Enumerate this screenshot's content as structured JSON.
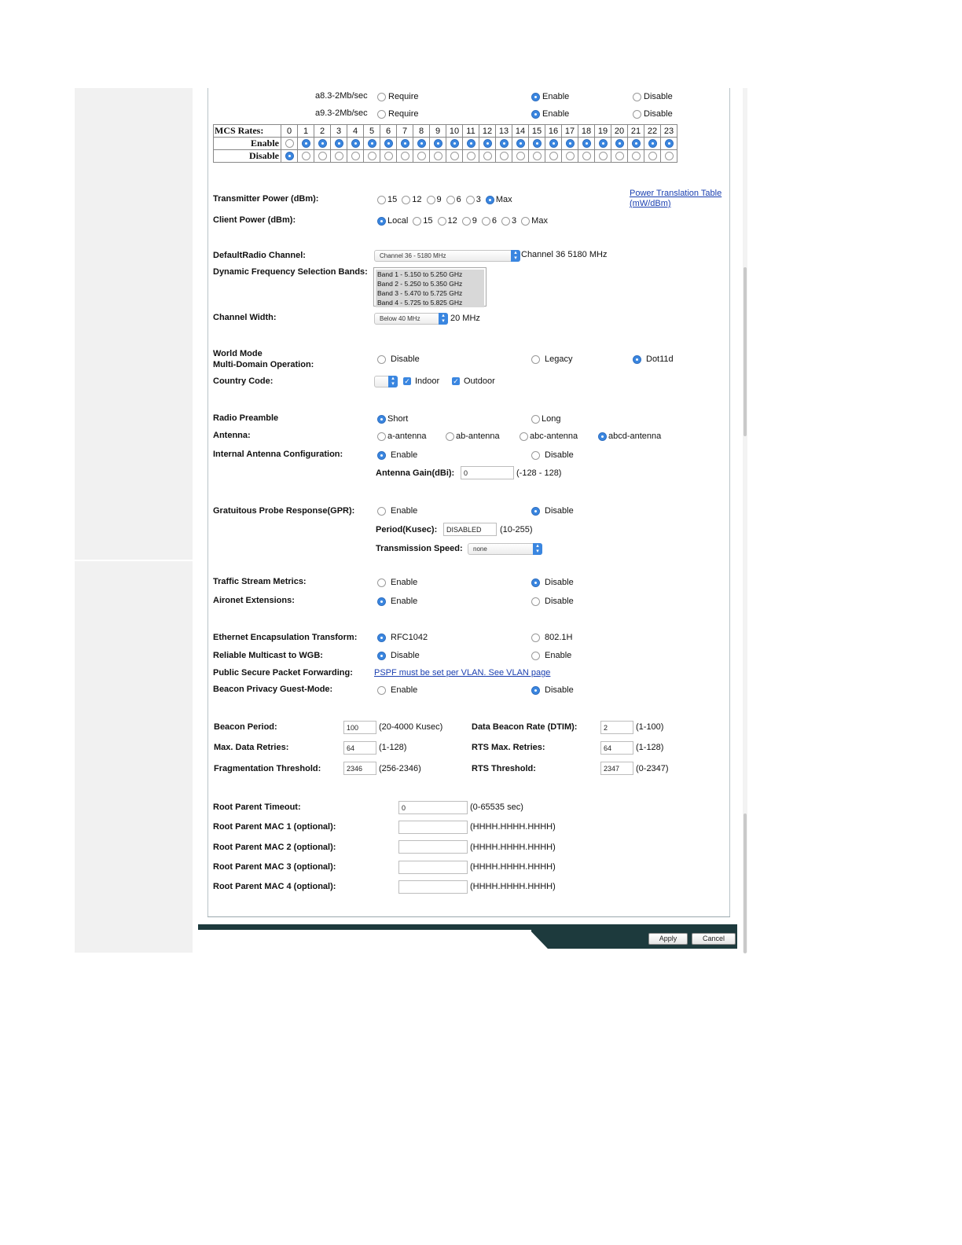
{
  "rates": [
    {
      "label": "a8.3-2Mb/sec",
      "require": "Require",
      "enable": "Enable",
      "disable": "Disable",
      "selected": "enable"
    },
    {
      "label": "a9.3-2Mb/sec",
      "require": "Require",
      "enable": "Enable",
      "disable": "Disable",
      "selected": "enable"
    }
  ],
  "mcs": {
    "header": "MCS Rates:",
    "enable_label": "Enable",
    "disable_label": "Disable",
    "indices": [
      "0",
      "1",
      "2",
      "3",
      "4",
      "5",
      "6",
      "7",
      "8",
      "9",
      "10",
      "11",
      "12",
      "13",
      "14",
      "15",
      "16",
      "17",
      "18",
      "19",
      "20",
      "21",
      "22",
      "23"
    ],
    "enabled": [
      false,
      true,
      true,
      true,
      true,
      true,
      true,
      true,
      true,
      true,
      true,
      true,
      true,
      true,
      true,
      true,
      true,
      true,
      true,
      true,
      true,
      true,
      true,
      true
    ]
  },
  "transmitter_power": {
    "label": "Transmitter Power (dBm):",
    "options": [
      "15",
      "12",
      "9",
      "6",
      "3",
      "Max"
    ],
    "selected": "Max",
    "link": "Power Translation Table",
    "link2": "(mW/dBm)"
  },
  "client_power": {
    "label": "Client Power (dBm):",
    "options": [
      "Local",
      "15",
      "12",
      "9",
      "6",
      "3",
      "Max"
    ],
    "selected": "Local"
  },
  "default_channel": {
    "label": "DefaultRadio Channel:",
    "value": "Channel 36 - 5180 MHz",
    "readout": "Channel 36 5180 MHz"
  },
  "dfs": {
    "label": "Dynamic Frequency Selection Bands:",
    "bands": [
      "Band 1 - 5.150 to 5.250 GHz",
      "Band 2 - 5.250 to 5.350 GHz",
      "Band 3 - 5.470 to 5.725 GHz",
      "Band 4 - 5.725 to 5.825 GHz"
    ]
  },
  "channel_width": {
    "label": "Channel Width:",
    "value": "Below 40 MHz",
    "readout": "20 MHz"
  },
  "world_mode": {
    "label1": "World Mode",
    "label2": "Multi-Domain Operation:",
    "options": [
      "Disable",
      "Legacy",
      "Dot11d"
    ],
    "selected": "Dot11d"
  },
  "country_code": {
    "label": "Country Code:",
    "indoor": "Indoor",
    "outdoor": "Outdoor"
  },
  "radio_preamble": {
    "label": "Radio Preamble",
    "short": "Short",
    "long": "Long",
    "selected": "Short"
  },
  "antenna": {
    "label": "Antenna:",
    "options": [
      "a-antenna",
      "ab-antenna",
      "abc-antenna",
      "abcd-antenna"
    ],
    "selected": "abcd-antenna"
  },
  "internal_antenna": {
    "label": "Internal Antenna Configuration:",
    "enable": "Enable",
    "disable": "Disable",
    "selected": "Enable",
    "gain_label": "Antenna Gain(dBi):",
    "gain_value": "0",
    "gain_range": "(-128 - 128)"
  },
  "gpr": {
    "label": "Gratuitous Probe Response(GPR):",
    "enable": "Enable",
    "disable": "Disable",
    "selected": "Disable",
    "period_label": "Period(Kusec):",
    "period_value": "DISABLED",
    "period_range": "(10-255)",
    "speed_label": "Transmission Speed:",
    "speed_value": "none"
  },
  "traffic_stream": {
    "label": "Traffic Stream Metrics:",
    "enable": "Enable",
    "disable": "Disable",
    "selected": "Disable"
  },
  "aironet": {
    "label": "Aironet Extensions:",
    "enable": "Enable",
    "disable": "Disable",
    "selected": "Enable"
  },
  "ethernet": {
    "label": "Ethernet Encapsulation Transform:",
    "opt1": "RFC1042",
    "opt2": "802.1H",
    "selected": "RFC1042"
  },
  "reliable_multicast": {
    "label": "Reliable Multicast to WGB:",
    "opt1": "Disable",
    "opt2": "Enable",
    "selected": "Disable"
  },
  "pspf": {
    "label": "Public Secure Packet Forwarding:",
    "link": "PSPF must be set per VLAN. See VLAN page"
  },
  "beacon_privacy": {
    "label": "Beacon Privacy Guest-Mode:",
    "enable": "Enable",
    "disable": "Disable",
    "selected": "Disable"
  },
  "params": {
    "beacon_period": {
      "label": "Beacon Period:",
      "value": "100",
      "range": "(20-4000 Kusec)"
    },
    "max_retries": {
      "label": "Max. Data Retries:",
      "value": "64",
      "range": "(1-128)"
    },
    "frag": {
      "label": "Fragmentation Threshold:",
      "value": "2346",
      "range": "(256-2346)"
    },
    "dtim": {
      "label": "Data Beacon Rate (DTIM):",
      "value": "2",
      "range": "(1-100)"
    },
    "rts_retries": {
      "label": "RTS Max. Retries:",
      "value": "64",
      "range": "(1-128)"
    },
    "rts_threshold": {
      "label": "RTS Threshold:",
      "value": "2347",
      "range": "(0-2347)"
    }
  },
  "root_parent": {
    "timeout_label": "Root Parent Timeout:",
    "timeout_value": "0",
    "timeout_range": "(0-65535 sec)",
    "mac1_label": "Root Parent MAC 1 (optional):",
    "mac2_label": "Root Parent MAC 2 (optional):",
    "mac3_label": "Root Parent MAC 3 (optional):",
    "mac4_label": "Root Parent MAC 4 (optional):",
    "mac_format": "(HHHH.HHHH.HHHH)"
  },
  "footer": {
    "apply": "Apply",
    "cancel": "Cancel"
  },
  "colors": {
    "accent": "#3a86e0",
    "footer": "#1d3a3d",
    "link": "#1a3fb0"
  }
}
